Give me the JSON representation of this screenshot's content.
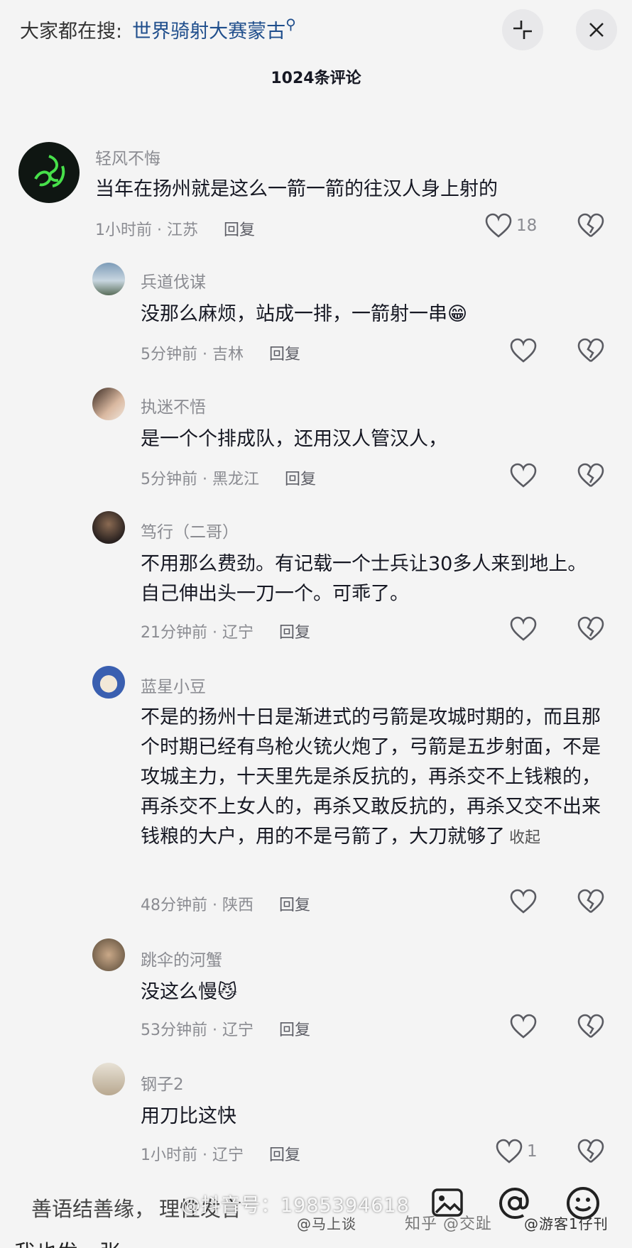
{
  "header": {
    "search_prefix": "大家都在搜:",
    "search_term": "世界骑射大赛蒙古",
    "comment_count": "1024条评论"
  },
  "comments": [
    {
      "user": "轻风不悔",
      "text": "当年在扬州就是这么一箭一箭的往汉人身上射的",
      "time": "1小时前 · 江苏",
      "reply": "回复",
      "likes": "18"
    },
    {
      "user": "兵道伐谋",
      "text": "没那么麻烦，站成一排，一箭射一串😁",
      "time": "5分钟前 · 吉林",
      "reply": "回复",
      "likes": ""
    },
    {
      "user": "执迷不悟",
      "text": "是一个个排成队，还用汉人管汉人，",
      "time": "5分钟前 · 黑龙江",
      "reply": "回复",
      "likes": ""
    },
    {
      "user": "笃行（二哥）",
      "text": "不用那么费劲。有记载一个士兵让30多人来到地上。自己伸出头一刀一个。可乖了。",
      "time": "21分钟前 · 辽宁",
      "reply": "回复",
      "likes": ""
    },
    {
      "user": "蓝星小豆",
      "text": "不是的扬州十日是渐进式的弓箭是攻城时期的，而且那个时期已经有鸟枪火铳火炮了，弓箭是五步射面，不是攻城主力，十天里先是杀反抗的，再杀交不上钱粮的，再杀交不上女人的，再杀又敢反抗的，再杀又交不出来钱粮的大户，用的不是弓箭了，大刀就够了",
      "fold": "收起",
      "time": "48分钟前 · 陕西",
      "reply": "回复",
      "likes": ""
    },
    {
      "user": "跳伞的河蟹",
      "text": "没这么慢😼",
      "time": "53分钟前 · 辽宁",
      "reply": "回复",
      "likes": ""
    },
    {
      "user": "钢子2",
      "text": "用刀比这快",
      "time": "1小时前 · 辽宁",
      "reply": "回复",
      "likes": "1"
    }
  ],
  "footer": {
    "input_placeholder": "善语结善缘，",
    "input_trailing": "理性发言",
    "watermark_main": "@抖音号：1985394618",
    "watermark_weibo": "@马上谈",
    "watermark_zhihu": "知乎 @交趾",
    "watermark_youke": "@游客1仔刊",
    "cut_text": "我也发一张"
  },
  "icons": {
    "shrink": "collapse-arrows-icon",
    "close": "close-icon",
    "like": "heart-outline-icon",
    "dislike": "broken-heart-icon",
    "image": "image-icon",
    "mention": "at-icon",
    "emoji": "emoji-icon"
  },
  "colors": {
    "background": "#f4f4f4",
    "search_term": "#1f4e8c",
    "secondary_text": "#8a8b91"
  }
}
